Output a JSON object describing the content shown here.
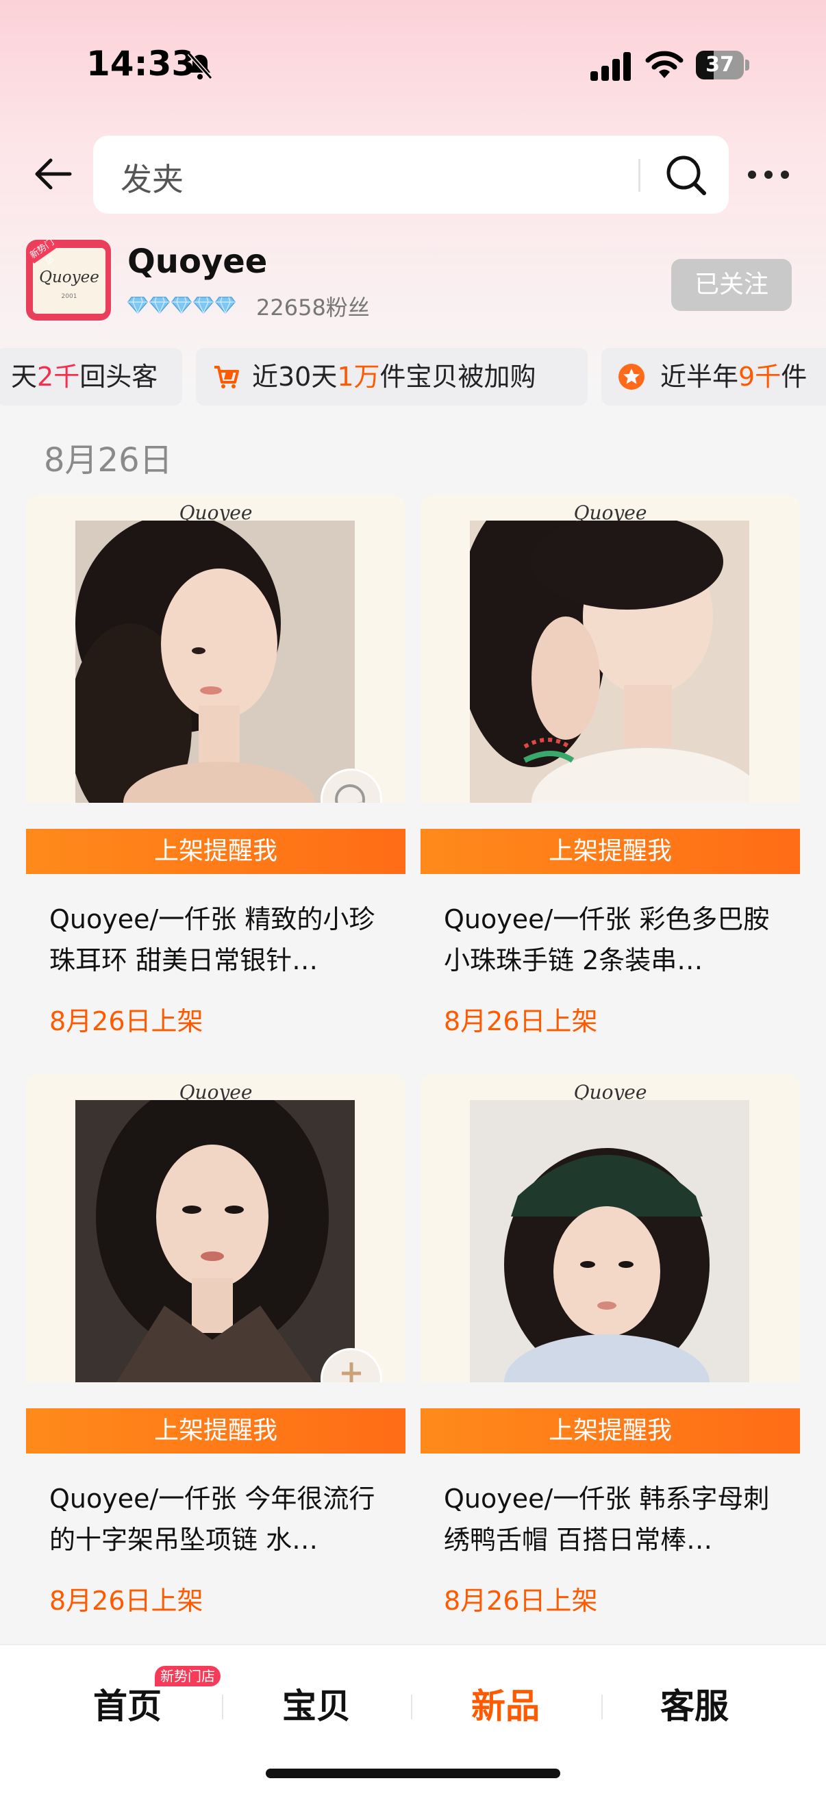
{
  "status_bar": {
    "time": "14:33",
    "battery": "37",
    "battery_level": 0.37
  },
  "search": {
    "query": "发夹"
  },
  "shop": {
    "name": "Quoyee",
    "logo_text": "Quoyee",
    "logo_subtext": "2001",
    "logo_badge": "新势门店",
    "diamonds": 5,
    "fans": "22658粉丝",
    "follow_label": "已关注"
  },
  "stats": [
    {
      "prefix": "天",
      "highlight": "2千",
      "suffix": "回头客"
    },
    {
      "prefix": "近30天",
      "highlight": "1万",
      "suffix": "件宝贝被加购"
    },
    {
      "prefix": "近半年",
      "highlight": "9千",
      "suffix": "件"
    }
  ],
  "date_header": "8月26日",
  "products": [
    {
      "logo": "Quoyee",
      "remind": "上架提醒我",
      "title": "Quoyee/一仟张 精致的小珍珠耳环 甜美日常银针…",
      "date": "8月26日上架"
    },
    {
      "logo": "Quoyee",
      "remind": "上架提醒我",
      "title": "Quoyee/一仟张 彩色多巴胺小珠珠手链 2条装串…",
      "date": "8月26日上架"
    },
    {
      "logo": "Quoyee",
      "remind": "上架提醒我",
      "title": "Quoyee/一仟张 今年很流行的十字架吊坠项链 水…",
      "date": "8月26日上架"
    },
    {
      "logo": "Quoyee",
      "remind": "上架提醒我",
      "title": "Quoyee/一仟张 韩系字母刺绣鸭舌帽 百搭日常棒…",
      "date": "8月26日上架"
    }
  ],
  "tabs": [
    {
      "label": "首页",
      "badge": "新势门店"
    },
    {
      "label": "宝贝"
    },
    {
      "label": "新品",
      "active": true
    },
    {
      "label": "客服"
    }
  ],
  "colors": {
    "accent": "#ff5a00",
    "remind_bar": "#ff7a18",
    "gradient_top": "#fbd2d8"
  }
}
